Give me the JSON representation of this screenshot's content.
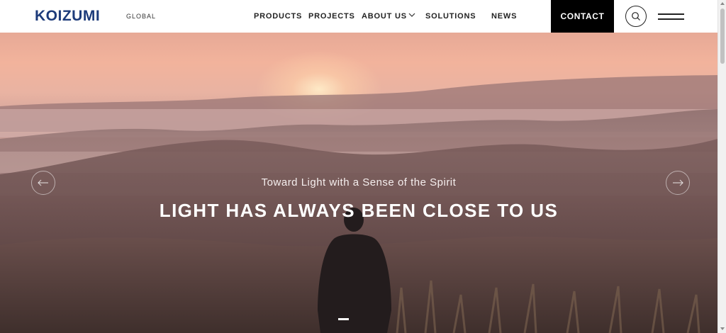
{
  "header": {
    "logo": "KOIZUMI",
    "logo_sub": "GLOBAL",
    "nav": [
      {
        "label": "PRODUCTS"
      },
      {
        "label": "PROJECTS"
      },
      {
        "label": "ABOUT US"
      },
      {
        "label": "SOLUTIONS"
      },
      {
        "label": "NEWS"
      }
    ],
    "contact_label": "CONTACT",
    "search_icon": "search-icon",
    "menu_icon": "hamburger-menu-icon"
  },
  "hero": {
    "subtitle": "Toward Light with a Sense of the Spirit",
    "title": "LIGHT HAS ALWAYS BEEN CLOSE TO US",
    "prev_icon": "arrow-left-icon",
    "next_icon": "arrow-right-icon"
  },
  "colors": {
    "brand": "#1d3b7a",
    "contact_bg": "#000000"
  }
}
